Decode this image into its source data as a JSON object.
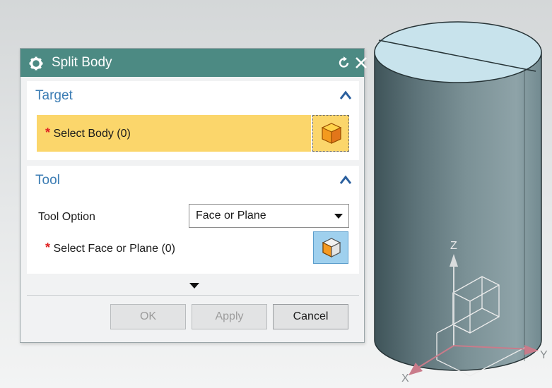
{
  "dialog": {
    "title": "Split Body",
    "icons": {
      "settings": "gear-icon",
      "reset": "reset-icon",
      "close": "close-icon"
    }
  },
  "target_group": {
    "title": "Target",
    "select_body": {
      "required_mark": "*",
      "label": "Select Body (0)",
      "icon": "solid-body-icon"
    }
  },
  "tool_group": {
    "title": "Tool",
    "tool_option_label": "Tool Option",
    "tool_option_value": "Face or Plane",
    "select_face": {
      "required_mark": "*",
      "label": "Select Face or Plane (0)",
      "icon": "face-select-icon"
    }
  },
  "buttons": {
    "ok": "OK",
    "apply": "Apply",
    "cancel": "Cancel"
  },
  "triad": {
    "z": "Z",
    "y": "Y",
    "x": "X"
  },
  "colors": {
    "titlebar": "#4c8a83",
    "group_title": "#3c7db4",
    "active_select": "#fbd66b",
    "face_button": "#9fd0ee",
    "cylinder_side": "#6f868c",
    "cylinder_top": "#c8e3ec"
  }
}
